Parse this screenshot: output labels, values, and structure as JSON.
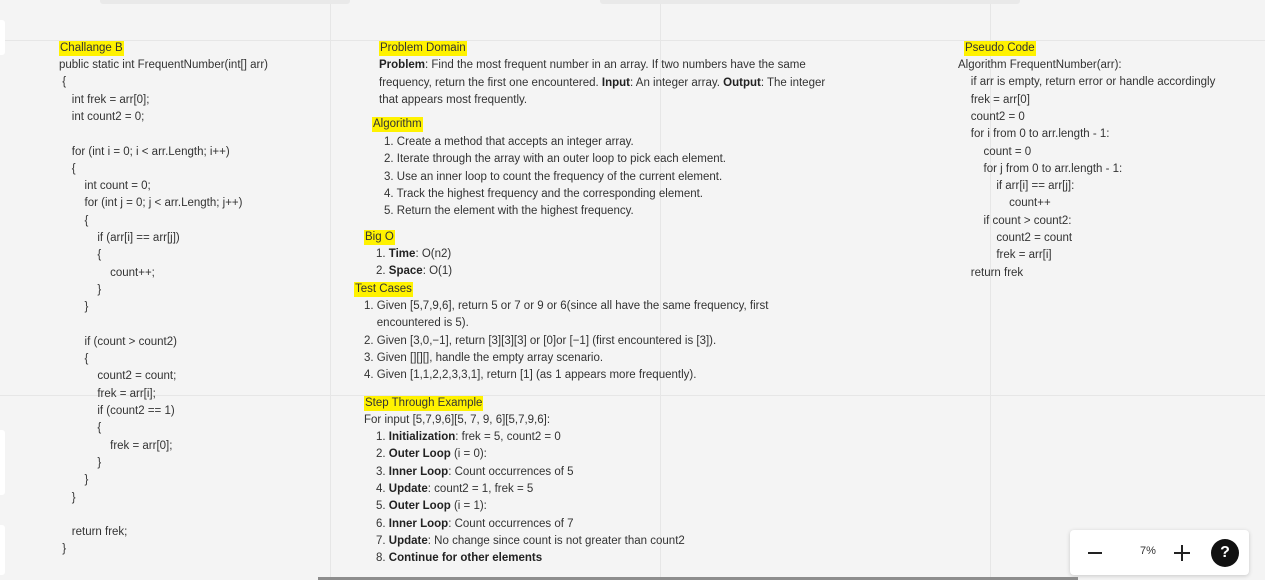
{
  "challenge": {
    "title": "Challange B",
    "code": [
      "public static int FrequentNumber(int[] arr)",
      " {",
      "    int frek = arr[0];",
      "    int count2 = 0;",
      "",
      "    for (int i = 0; i < arr.Length; i++)",
      "    {",
      "        int count = 0;",
      "        for (int j = 0; j < arr.Length; j++)",
      "        {",
      "            if (arr[i] == arr[j])",
      "            {",
      "                count++;",
      "            }",
      "        }",
      "",
      "        if (count > count2)",
      "        {",
      "            count2 = count;",
      "            frek = arr[i];",
      "            if (count2 == 1)",
      "            {",
      "                frek = arr[0];",
      "            }",
      "        }",
      "    }",
      "",
      "    return frek;",
      " }"
    ]
  },
  "problem": {
    "title": "Problem Domain",
    "lines": [
      [
        {
          "b": "Problem"
        },
        {
          "t": ": Find the most frequent number in an array. If two numbers have the same"
        }
      ],
      [
        {
          "t": "frequency, return the first one encountered. "
        },
        {
          "b": "Input"
        },
        {
          "t": ": An integer array. "
        },
        {
          "b": "Output"
        },
        {
          "t": ": The integer"
        }
      ],
      [
        {
          "t": "that appears most frequently."
        }
      ]
    ]
  },
  "algorithm": {
    "title": "Algorithm",
    "items": [
      "1. Create a method that accepts an integer array.",
      "2. Iterate through the array with an outer loop to pick each element.",
      "3. Use an inner loop to count the frequency of the current element.",
      "4. Track the highest frequency and the corresponding element.",
      "5. Return the element with the highest frequency."
    ]
  },
  "bigo": {
    "title": "Big O",
    "items": [
      [
        {
          "t": "1. "
        },
        {
          "b": "Time"
        },
        {
          "t": ": O(n2)"
        }
      ],
      [
        {
          "t": "2. "
        },
        {
          "b": "Space"
        },
        {
          "t": ": O(1)"
        }
      ]
    ]
  },
  "tests": {
    "title": "Test Cases",
    "lines": [
      "1. Given [5,7,9,6], return 5 or 7 or 9 or 6(since all have the same frequency, first",
      "    encountered is 5).",
      "2. Given [3,0,−1], return [3][3][3] or [0]or [−1] (first encountered is [3]).",
      "3. Given [][][], handle the empty array scenario.",
      "4. Given [1,1,2,2,3,3,1], return [1] (as 1 appears more frequently)."
    ]
  },
  "step": {
    "title": "Step Through Example",
    "intro": "For input [5,7,9,6][5, 7, 9, 6][5,7,9,6]:",
    "items": [
      [
        {
          "t": "1. "
        },
        {
          "b": "Initialization"
        },
        {
          "t": ": frek = 5, count2 = 0"
        }
      ],
      [
        {
          "t": "2. "
        },
        {
          "b": "Outer Loop"
        },
        {
          "t": " (i = 0):"
        }
      ],
      [
        {
          "t": "3. "
        },
        {
          "b": "Inner Loop"
        },
        {
          "t": ": Count occurrences of 5"
        }
      ],
      [
        {
          "t": "4. "
        },
        {
          "b": "Update"
        },
        {
          "t": ": count2 = 1, frek = 5"
        }
      ],
      [
        {
          "t": "5. "
        },
        {
          "b": "Outer Loop"
        },
        {
          "t": " (i = 1):"
        }
      ],
      [
        {
          "t": "6. "
        },
        {
          "b": "Inner Loop"
        },
        {
          "t": ": Count occurrences of 7"
        }
      ],
      [
        {
          "t": "7. "
        },
        {
          "b": "Update"
        },
        {
          "t": ": No change since count is not greater than count2"
        }
      ],
      [
        {
          "t": "8. "
        },
        {
          "b": "Continue for other elements"
        }
      ]
    ]
  },
  "pseudo": {
    "title": "Pseudo Code",
    "lines": [
      "Algorithm FrequentNumber(arr):",
      "    if arr is empty, return error or handle accordingly",
      "    frek = arr[0]",
      "    count2 = 0",
      "    for i from 0 to arr.length - 1:",
      "        count = 0",
      "        for j from 0 to arr.length - 1:",
      "            if arr[i] == arr[j]:",
      "                count++",
      "        if count > count2:",
      "            count2 = count",
      "            frek = arr[i]",
      "    return frek"
    ]
  },
  "zoom": {
    "minus": "−",
    "level": "7%",
    "plus": "+",
    "help": "?"
  }
}
